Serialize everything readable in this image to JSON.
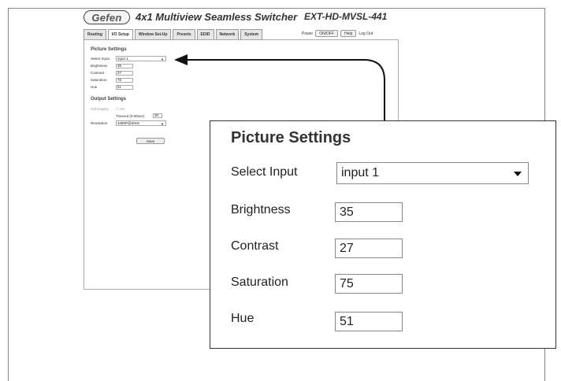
{
  "header": {
    "logo_text": "Gefen",
    "app_title": "4x1 Multiview Seamless Switcher",
    "model": "EXT-HD-MVSL-441"
  },
  "tabs": [
    {
      "label": "Routing"
    },
    {
      "label": "I/O Setup",
      "active": true
    },
    {
      "label": "Window Set-Up"
    },
    {
      "label": "Presets"
    },
    {
      "label": "EDID"
    },
    {
      "label": "Network"
    },
    {
      "label": "System"
    }
  ],
  "topbar": {
    "power_label": "Power",
    "power_button": "ON/OFF",
    "help_button": "Help",
    "logout": "Log Out"
  },
  "picture_settings": {
    "title": "Picture Settings",
    "select_input_label": "Select Input",
    "select_input_value": "input 1",
    "brightness_label": "Brightness",
    "brightness_value": "35",
    "contrast_label": "Contrast",
    "contrast_value": "27",
    "saturation_label": "Saturation",
    "saturation_value": "75",
    "hue_label": "Hue",
    "hue_value": "51"
  },
  "output_settings": {
    "title": "Output Settings",
    "hdmi_label": "Hdt Display",
    "hdmi_checkbox_label": "On",
    "timeout_label": "Timeout (0-60sec)",
    "timeout_value": "30",
    "resolution_label": "Resolution",
    "resolution_value": "1080P@60Hz"
  },
  "save_label": "Save",
  "colors": {
    "border": "#888888",
    "tab_bg": "#e6e6e6",
    "callout_border": "#333333"
  }
}
